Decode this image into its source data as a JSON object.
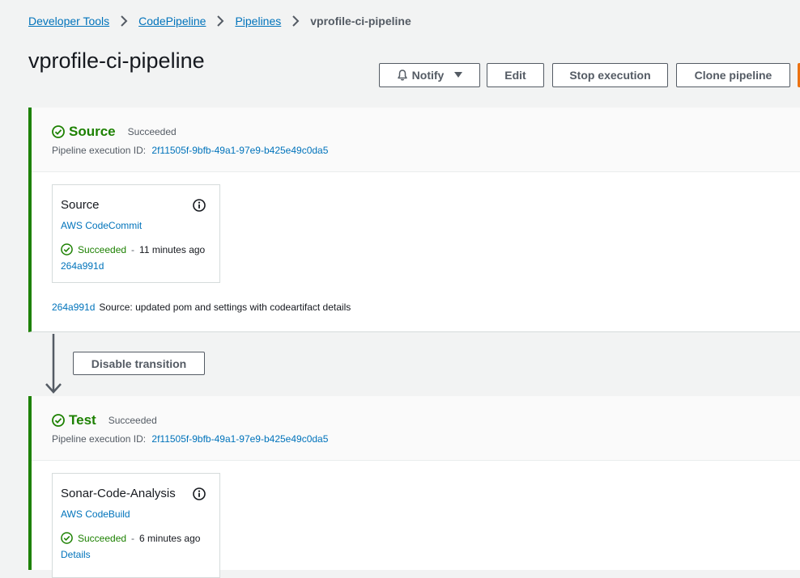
{
  "breadcrumb": {
    "items": [
      "Developer Tools",
      "CodePipeline",
      "Pipelines"
    ],
    "current": "vprofile-ci-pipeline"
  },
  "page": {
    "title": "vprofile-ci-pipeline"
  },
  "header_actions": {
    "notify": "Notify",
    "edit": "Edit",
    "stop": "Stop execution",
    "clone": "Clone pipeline"
  },
  "stages": [
    {
      "name": "Source",
      "status": "Succeeded",
      "exec_label": "Pipeline execution ID:",
      "exec_id": "2f11505f-9bfb-49a1-97e9-b425e49c0da5",
      "action": {
        "title": "Source",
        "provider": "AWS CodeCommit",
        "status": "Succeeded",
        "time": "11 minutes ago",
        "link": "264a991d"
      },
      "commit": {
        "id": "264a991d",
        "message": "Source: updated pom and settings with codeartifact details"
      }
    },
    {
      "name": "Test",
      "status": "Succeeded",
      "exec_label": "Pipeline execution ID:",
      "exec_id": "2f11505f-9bfb-49a1-97e9-b425e49c0da5",
      "action": {
        "title": "Sonar-Code-Analysis",
        "provider": "AWS CodeBuild",
        "status": "Succeeded",
        "time": "6 minutes ago",
        "link": "Details"
      }
    }
  ],
  "transition": {
    "button": "Disable transition"
  },
  "colors": {
    "success": "#1d8102",
    "link": "#0073bb",
    "primary": "#ec7211"
  },
  "icons": [
    "chevron-right-icon",
    "bell-icon",
    "caret-down-icon",
    "check-circle-icon",
    "info-icon",
    "arrow-down-icon"
  ]
}
